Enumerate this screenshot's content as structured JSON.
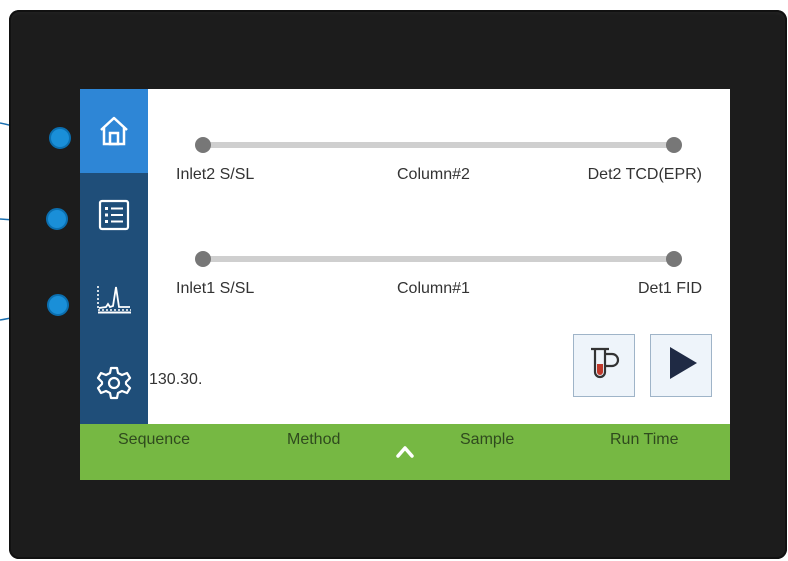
{
  "sidebar": {
    "items": [
      {
        "name": "home",
        "icon": "home-icon",
        "active": true
      },
      {
        "name": "list",
        "icon": "list-icon",
        "active": false
      },
      {
        "name": "chromatogram",
        "icon": "chromatogram-icon",
        "active": false
      },
      {
        "name": "settings",
        "icon": "gear-icon",
        "active": false
      }
    ]
  },
  "flow_paths": [
    {
      "inlet": "Inlet2 S/SL",
      "column": "Column#2",
      "detector": "Det2 TCD(EPR)"
    },
    {
      "inlet": "Inlet1 S/SL",
      "column": "Column#1",
      "detector": "Det1 FID"
    }
  ],
  "status_value": "130.30.",
  "controls": {
    "sample_icon": "sample-vial-icon",
    "run_icon": "play-icon"
  },
  "bottom_tabs": [
    "Sequence",
    "Method",
    "Sample",
    "Run Time"
  ],
  "colors": {
    "sidebar": "#1f4e79",
    "sidebar_active": "#2e86d6",
    "bottom_bar": "#76b843",
    "callout": "#1a8fd8"
  }
}
